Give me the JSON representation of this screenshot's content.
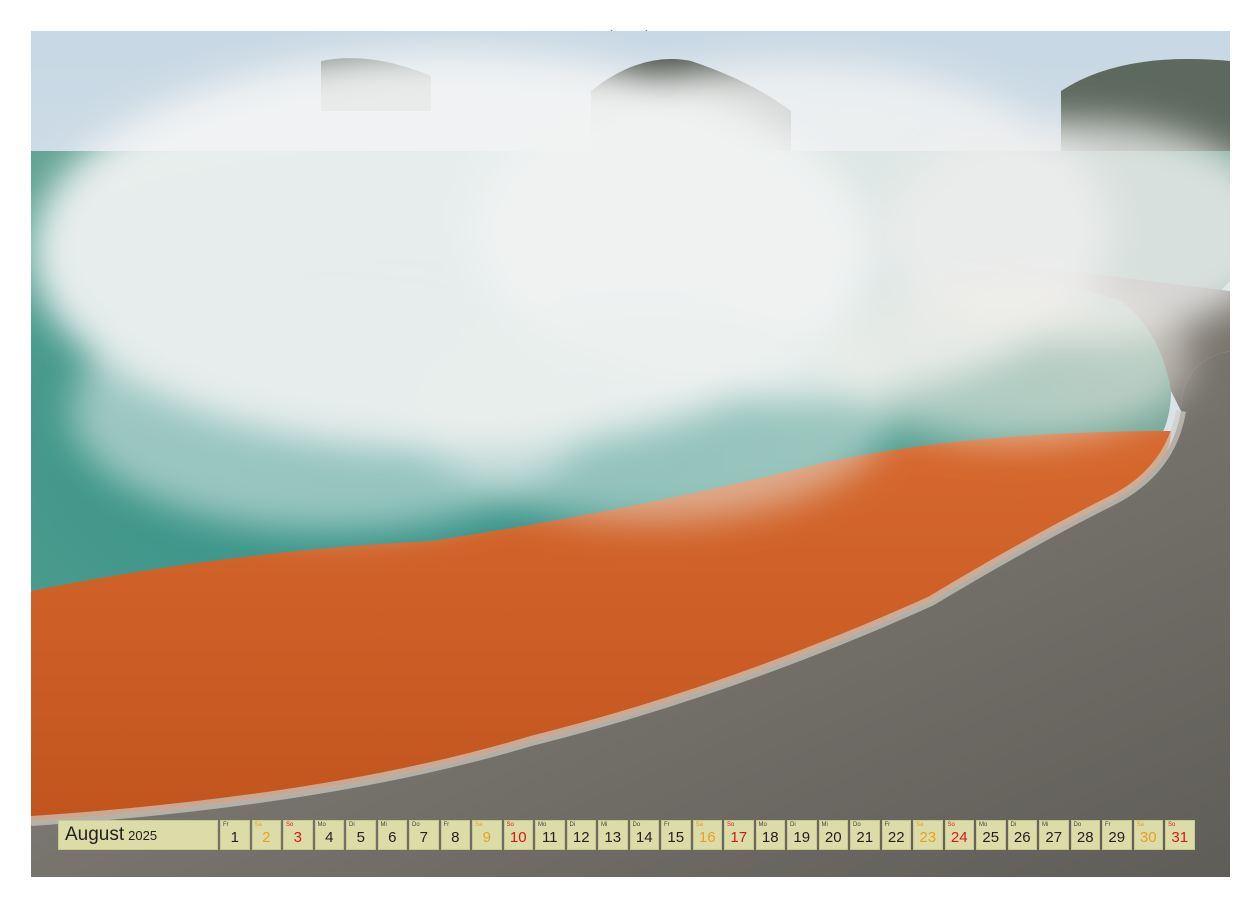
{
  "calendar": {
    "month": "August",
    "year": "2025",
    "colors": {
      "weekday": "#222222",
      "saturday": "#e8a020",
      "sunday": "#d81818",
      "cell_bg": "#dcdca8"
    },
    "days": [
      {
        "wd": "Fr",
        "n": "1",
        "t": "wd"
      },
      {
        "wd": "Sa",
        "n": "2",
        "t": "sat"
      },
      {
        "wd": "So",
        "n": "3",
        "t": "sun"
      },
      {
        "wd": "Mo",
        "n": "4",
        "t": "wd"
      },
      {
        "wd": "Di",
        "n": "5",
        "t": "wd"
      },
      {
        "wd": "Mi",
        "n": "6",
        "t": "wd"
      },
      {
        "wd": "Do",
        "n": "7",
        "t": "wd"
      },
      {
        "wd": "Fr",
        "n": "8",
        "t": "wd"
      },
      {
        "wd": "Sa",
        "n": "9",
        "t": "sat"
      },
      {
        "wd": "So",
        "n": "10",
        "t": "sun"
      },
      {
        "wd": "Mo",
        "n": "11",
        "t": "wd"
      },
      {
        "wd": "Di",
        "n": "12",
        "t": "wd"
      },
      {
        "wd": "Mi",
        "n": "13",
        "t": "wd"
      },
      {
        "wd": "Do",
        "n": "14",
        "t": "wd"
      },
      {
        "wd": "Fr",
        "n": "15",
        "t": "wd"
      },
      {
        "wd": "Sa",
        "n": "16",
        "t": "sat"
      },
      {
        "wd": "So",
        "n": "17",
        "t": "sun"
      },
      {
        "wd": "Mo",
        "n": "18",
        "t": "wd"
      },
      {
        "wd": "Di",
        "n": "19",
        "t": "wd"
      },
      {
        "wd": "Mi",
        "n": "20",
        "t": "wd"
      },
      {
        "wd": "Do",
        "n": "21",
        "t": "wd"
      },
      {
        "wd": "Fr",
        "n": "22",
        "t": "wd"
      },
      {
        "wd": "Sa",
        "n": "23",
        "t": "sat"
      },
      {
        "wd": "So",
        "n": "24",
        "t": "sun"
      },
      {
        "wd": "Mo",
        "n": "25",
        "t": "wd"
      },
      {
        "wd": "Di",
        "n": "26",
        "t": "wd"
      },
      {
        "wd": "Mi",
        "n": "27",
        "t": "wd"
      },
      {
        "wd": "Do",
        "n": "28",
        "t": "wd"
      },
      {
        "wd": "Fr",
        "n": "29",
        "t": "wd"
      },
      {
        "wd": "Sa",
        "n": "30",
        "t": "sat"
      },
      {
        "wd": "So",
        "n": "31",
        "t": "sun"
      }
    ]
  }
}
